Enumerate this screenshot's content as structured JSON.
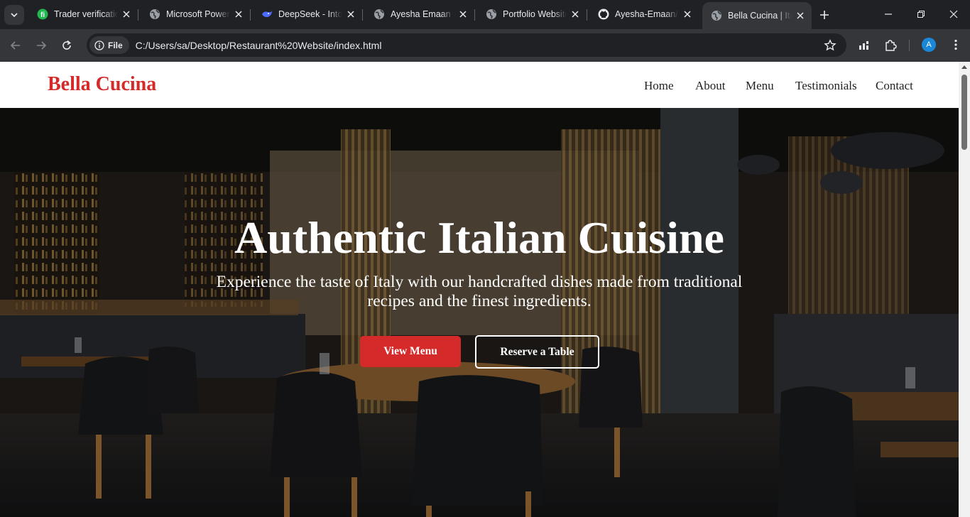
{
  "browser": {
    "tabs": [
      {
        "title": "Trader verification",
        "icon": "green-app-icon",
        "active": false
      },
      {
        "title": "Microsoft Power",
        "icon": "globe-icon",
        "active": false
      },
      {
        "title": "DeepSeek - Into",
        "icon": "deepseek-whale-icon",
        "active": false
      },
      {
        "title": "Ayesha Emaan -",
        "icon": "globe-icon",
        "active": false
      },
      {
        "title": "Portfolio Website",
        "icon": "globe-icon",
        "active": false
      },
      {
        "title": "Ayesha-Emaan/C",
        "icon": "github-icon",
        "active": false
      },
      {
        "title": "Bella Cucina | Ita",
        "icon": "globe-icon",
        "active": true
      }
    ],
    "address_bar": {
      "scheme_chip": "File",
      "url": "C:/Users/sa/Desktop/Restaurant%20Website/index.html"
    },
    "profile_initial": "A",
    "colors": {
      "frame": "#202124",
      "toolbar": "#35363a",
      "avatar": "#1a88d6"
    }
  },
  "site": {
    "brand": "Bella Cucina",
    "nav": [
      "Home",
      "About",
      "Menu",
      "Testimonials",
      "Contact"
    ],
    "hero": {
      "title": "Authentic Italian Cuisine",
      "subtitle": "Experience the taste of Italy with our handcrafted dishes made from traditional recipes and the finest ingredients.",
      "primary_button": "View Menu",
      "secondary_button": "Reserve a Table"
    },
    "colors": {
      "brand": "#d42a2a",
      "header_bg": "#ffffff",
      "text_on_hero": "#ffffff"
    }
  }
}
